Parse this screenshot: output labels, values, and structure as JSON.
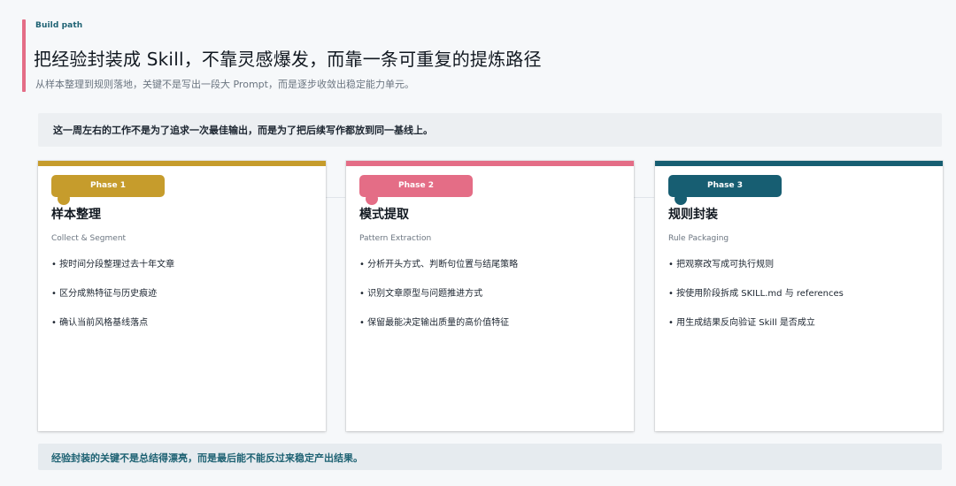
{
  "header": {
    "eyebrow": "Build path",
    "title": "把经验封装成 Skill，不靠灵感爆发，而靠一条可重复的提炼路径",
    "subtitle": "从样本整理到规则落地，关键不是写出一段大 Prompt，而是逐步收敛出稳定能力单元。"
  },
  "lead": "这一周左右的工作不是为了追求一次最佳输出，而是为了把后续写作都放到同一基线上。",
  "phases": [
    {
      "label": "Phase 1",
      "title": "样本整理",
      "subtitle": "Collect & Segment",
      "color": "#c69c2c",
      "items": [
        "按时间分段整理过去十年文章",
        "区分成熟特征与历史痕迹",
        "确认当前风格基线落点"
      ]
    },
    {
      "label": "Phase 2",
      "title": "模式提取",
      "subtitle": "Pattern Extraction",
      "color": "#e46d86",
      "items": [
        "分析开头方式、判断句位置与结尾策略",
        "识别文章原型与问题推进方式",
        "保留最能决定输出质量的高价值特征"
      ]
    },
    {
      "label": "Phase 3",
      "title": "规则封装",
      "subtitle": "Rule Packaging",
      "color": "#175e72",
      "items": [
        "把观察改写成可执行规则",
        "按使用阶段拆成 SKILL.md 与 references",
        "用生成结果反向验证 Skill 是否成立"
      ]
    }
  ],
  "footer": "经验封装的关键不是总结得漂亮，而是最后能不能反过来稳定产出结果。"
}
